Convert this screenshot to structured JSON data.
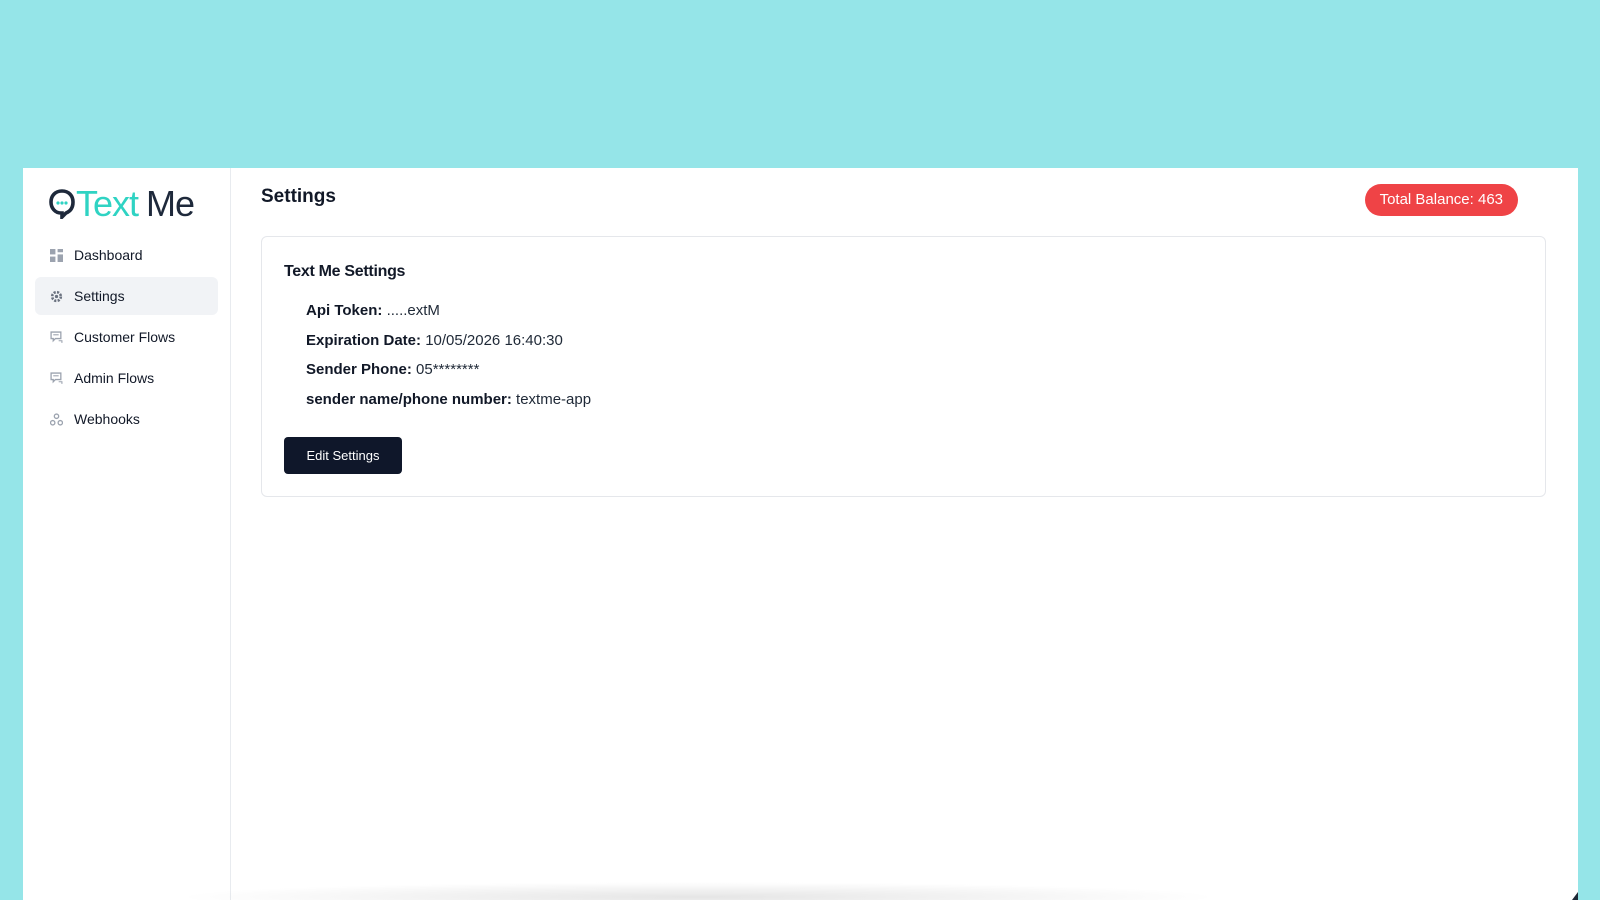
{
  "app": {
    "logo_part_a": "Text",
    "logo_part_b": "Me",
    "accent_color": "#2fd3c3"
  },
  "sidebar": {
    "items": [
      {
        "label": "Dashboard",
        "icon": "grid-icon",
        "active": false
      },
      {
        "label": "Settings",
        "icon": "gear-icon",
        "active": true
      },
      {
        "label": "Customer Flows",
        "icon": "chat-flow-icon",
        "active": false
      },
      {
        "label": "Admin Flows",
        "icon": "chat-flow-icon",
        "active": false
      },
      {
        "label": "Webhooks",
        "icon": "webhook-icon",
        "active": false
      }
    ]
  },
  "header": {
    "title": "Settings",
    "balance_label": "Total Balance: 463",
    "balance_color": "#ef4346"
  },
  "card": {
    "title": "Text Me Settings",
    "rows": [
      {
        "key": "Api Token:",
        "value": ".....extM"
      },
      {
        "key": "Expiration Date:",
        "value": "10/05/2026 16:40:30"
      },
      {
        "key": "Sender Phone:",
        "value": "05********"
      },
      {
        "key": "sender name/phone number:",
        "value": "textme-app"
      }
    ],
    "edit_button": "Edit Settings"
  }
}
